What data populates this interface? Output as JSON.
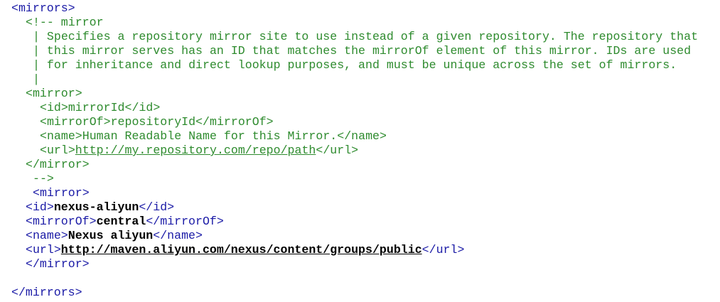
{
  "code": {
    "open_mirrors": "<mirrors>",
    "comment_open": "<!-- mirror",
    "comment_lines": [
      "| Specifies a repository mirror site to use instead of a given repository. The repository that",
      "| this mirror serves has an ID that matches the mirrorOf element of this mirror. IDs are used",
      "| for inheritance and direct lookup purposes, and must be unique across the set of mirrors.",
      "|"
    ],
    "c_mirror_open": "<mirror>",
    "c_id_open": "<id>",
    "c_id_val": "mirrorId",
    "c_id_close": "</id>",
    "c_mirrorof_open": "<mirrorOf>",
    "c_mirrorof_val": "repositoryId",
    "c_mirrorof_close": "</mirrorOf>",
    "c_name_open": "<name>",
    "c_name_val": "Human Readable Name for this Mirror.",
    "c_name_close": "</name>",
    "c_url_open": "<url>",
    "c_url_val": "http://my.repository.com/repo/path",
    "c_url_close": "</url>",
    "c_mirror_close": "</mirror>",
    "comment_close": "-->",
    "mirror_open": "<mirror>",
    "id_open": "<id>",
    "id_val": "nexus-aliyun",
    "id_close": "</id>",
    "mirrorof_open": "<mirrorOf>",
    "mirrorof_val": "central",
    "mirrorof_close": "</mirrorOf>",
    "name_open": "<name>",
    "name_val": "Nexus aliyun",
    "name_close": "</name>",
    "url_open": "<url>",
    "url_val": "http://maven.aliyun.com/nexus/content/groups/public",
    "url_close": "</url>",
    "mirror_close": "</mirror>",
    "close_mirrors": "</mirrors>"
  },
  "colors": {
    "tag": "#1a1aa6",
    "comment": "#2e8b2e",
    "value": "#000000"
  }
}
